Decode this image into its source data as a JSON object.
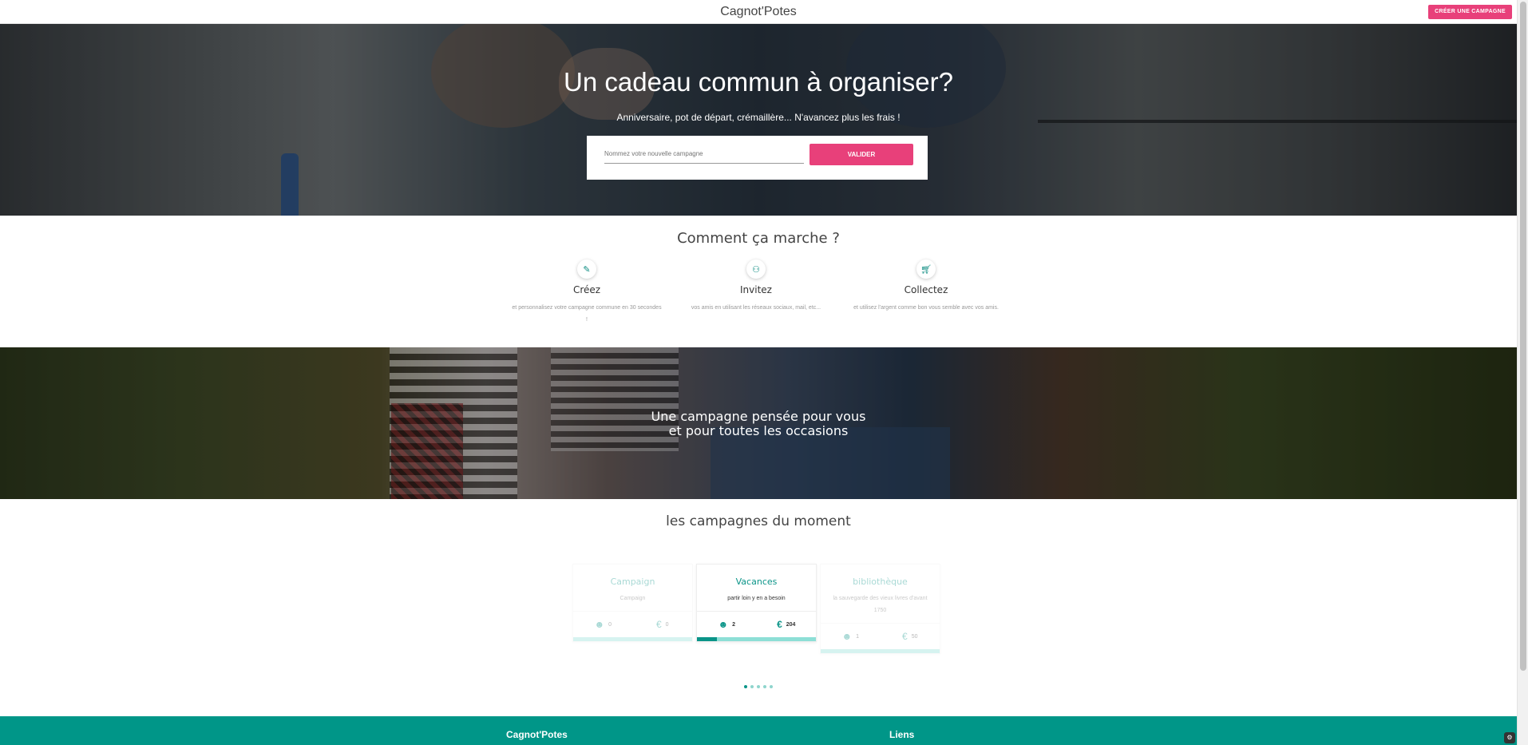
{
  "nav": {
    "brand": "Cagnot'Potes",
    "cta_label": "CRÉER UNE CAMPAGNE"
  },
  "hero": {
    "title": "Un cadeau commun à organiser?",
    "subtitle": "Anniversaire, pot de départ, crémaillère... N'avancez plus les frais !",
    "input_placeholder": "Nommez votre nouvelle campagne",
    "submit_label": "VALIDER"
  },
  "how": {
    "title": "Comment ça marche ?",
    "steps": [
      {
        "icon": "pencil-icon",
        "title": "Créez",
        "desc": "et personnalisez votre campagne commune en 30 secondes !"
      },
      {
        "icon": "people-icon",
        "title": "Invitez",
        "desc": "vos amis en utilisant les réseaux sociaux, mail, etc..."
      },
      {
        "icon": "cart-icon",
        "title": "Collectez",
        "desc": "et utilisez l'argent comme bon vous semble avec vos amis."
      }
    ]
  },
  "band": {
    "line1": "Une campagne pensée pour vous",
    "line2": "et pour toutes les occasions"
  },
  "campaigns": {
    "title": "les campagnes du moment",
    "items": [
      {
        "title": "Campaign",
        "desc": "Campaign",
        "participants": "0",
        "amount": "0",
        "progress": 0
      },
      {
        "title": "Vacances",
        "desc": "partir loin y en a besoin",
        "participants": "2",
        "amount": "204",
        "progress": 0.17
      },
      {
        "title": "bibliothèque",
        "desc": "la sauvegarde des vieux livres d'avant 1750",
        "participants": "1",
        "amount": "50",
        "progress": 0
      }
    ],
    "dots_count": 5,
    "active_dot": 0
  },
  "footer": {
    "col1": "Cagnot'Potes",
    "col2": "Liens"
  },
  "colors": {
    "accent_pink": "#e8407a",
    "teal": "#009688",
    "teal_text": "#0a9488"
  }
}
